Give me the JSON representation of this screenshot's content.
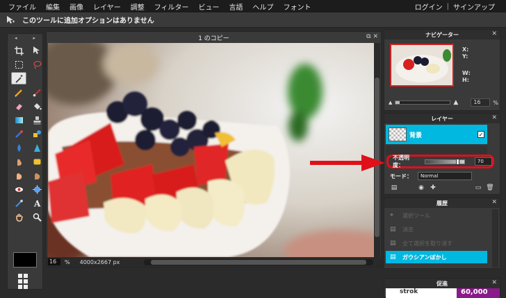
{
  "menubar": {
    "items": [
      "ファイル",
      "編集",
      "画像",
      "レイヤー",
      "調整",
      "フィルター",
      "ビュー",
      "言語",
      "ヘルプ",
      "フォント"
    ],
    "login": "ログイン",
    "separator": "|",
    "signup": "サインアップ"
  },
  "options_bar": {
    "message": "このツールに追加オプションはありません"
  },
  "tools": {
    "scroll_left": "◂",
    "scroll_right": "▸"
  },
  "document": {
    "title": "1 のコピー",
    "zoom_value": "16",
    "zoom_unit": "%",
    "dimensions": "4000x2667 px"
  },
  "navigator": {
    "title": "ナビゲーター",
    "x_label": "X:",
    "y_label": "Y:",
    "w_label": "W:",
    "h_label": "H:",
    "zoom_value": "16",
    "zoom_unit": "%"
  },
  "layers": {
    "title": "レイヤー",
    "layer_name": "背景",
    "opacity_label": "不透明度：",
    "opacity_value": "70",
    "mode_label": "モード：",
    "mode_value": "Normal"
  },
  "history": {
    "title": "履歴",
    "items": [
      "選択ツール",
      "消去",
      "全て選択を取り消す",
      "ガウシアンぼかし"
    ]
  },
  "promo": {
    "title": "促進",
    "ad_text": "strok",
    "ad_number": "60,000"
  },
  "colors": {
    "accent": "#00b8e0",
    "highlight_ring": "#e0101a",
    "panel_bg": "#3a3a3a"
  }
}
